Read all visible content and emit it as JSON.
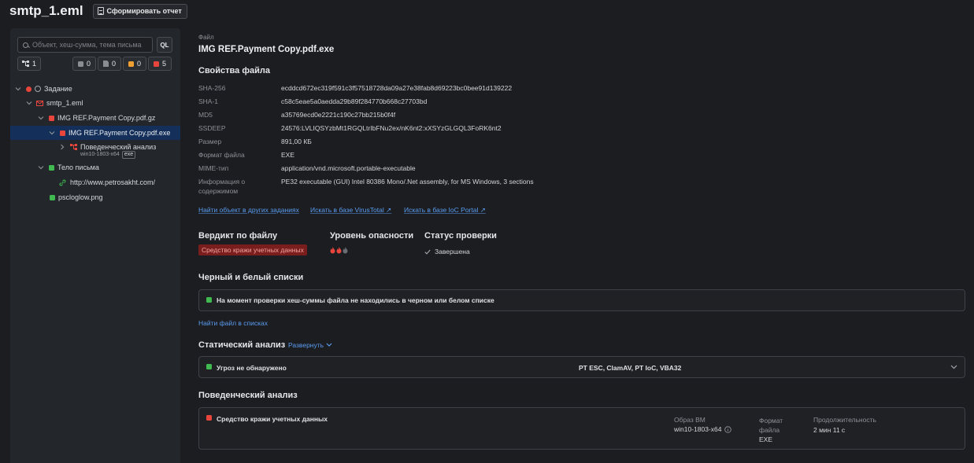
{
  "header": {
    "title": "smtp_1.eml",
    "report_button": "Сформировать отчет"
  },
  "sidebar": {
    "search_placeholder": "Объект, хеш-сумма, тема письма",
    "ql_label": "QL",
    "counters": [
      {
        "icon": "tree-icon",
        "value": "1"
      },
      {
        "icon": "gray-square-icon",
        "value": "0",
        "color": "#8a8d93"
      },
      {
        "icon": "gray-doc-icon",
        "value": "0",
        "color": "#8a8d93"
      },
      {
        "icon": "orange-square-icon",
        "value": "0",
        "color": "#f0a030"
      },
      {
        "icon": "red-square-icon",
        "value": "5",
        "color": "#e8453c"
      }
    ],
    "tree": [
      {
        "label": "Задание",
        "status": "red"
      },
      {
        "label": "smtp_1.eml",
        "status": "red-mail"
      },
      {
        "label": "IMG REF.Payment Copy.pdf.gz",
        "status": "red"
      },
      {
        "label": "IMG REF.Payment Copy.pdf.exe",
        "status": "red",
        "selected": true
      },
      {
        "label": "Поведенческий анализ",
        "sub": "win10-1803-x64",
        "tag": "exe",
        "status": "red-behavior"
      },
      {
        "label": "Тело письма",
        "status": "green"
      },
      {
        "label": "http://www.petrosakht.com/",
        "status": "green-link"
      },
      {
        "label": "pscloglow.png",
        "status": "green"
      }
    ]
  },
  "file": {
    "caption": "Файл",
    "name": "IMG REF.Payment Copy.pdf.exe",
    "props_title": "Свойства файла",
    "props": [
      {
        "key": "SHA-256",
        "value": "ecddcd672ec319f591c3f57518728da09a27e38fab8d69223bc0bee91d139222"
      },
      {
        "key": "SHA-1",
        "value": "c58c5eae5a0aedda29b89f284770b668c27703bd"
      },
      {
        "key": "MD5",
        "value": "a35769ecd0e2221c190c27bb215b0f4f"
      },
      {
        "key": "SSDEEP",
        "value": "24576:LVLIQSYzbMt1RGQLtrIbFNu2ex/nK6nt2:xXSYzGLGQL3FoRK6nt2"
      },
      {
        "key": "Размер",
        "value": "891,00 КБ"
      },
      {
        "key": "Формат файла",
        "value": "EXE"
      },
      {
        "key": "MIME-тип",
        "value": "application/vnd.microsoft.portable-executable"
      },
      {
        "key": "Информация о содержимом",
        "value": "PE32 executable (GUI) Intel 80386 Mono/.Net assembly, for MS Windows, 3 sections"
      }
    ],
    "links": [
      "Найти объект в других заданиях",
      "Искать в базе VirusTotal ↗",
      "Искать в базе IoC Portal ↗"
    ]
  },
  "verdict": {
    "title": "Вердикт по файлу",
    "value": "Средство кражи учетных данных",
    "danger_title": "Уровень опасности",
    "danger_level": 2,
    "danger_max": 3,
    "status_title": "Статус проверки",
    "status_value": "Завершена"
  },
  "lists": {
    "title": "Черный и белый списки",
    "message": "На момент проверки хеш-суммы файла не находились в черном или белом списке",
    "link": "Найти файл в списках"
  },
  "static": {
    "title": "Статический анализ",
    "expand": "Развернуть",
    "result": "Угроз не обнаружено",
    "engines": "PT ESC, ClamAV, PT IoC, VBA32"
  },
  "behavior": {
    "title": "Поведенческий анализ",
    "result": "Средство кражи учетных данных",
    "vm_label": "Образ ВМ",
    "vm_value": "win10-1803-x64",
    "format_label": "Формат файла",
    "format_value": "EXE",
    "duration_label": "Продолжительность",
    "duration_value": "2 мин 11 с"
  },
  "colors": {
    "red": "#e8453c",
    "green": "#3fb950",
    "link": "#5b9cf0",
    "selected": "#14305a"
  }
}
